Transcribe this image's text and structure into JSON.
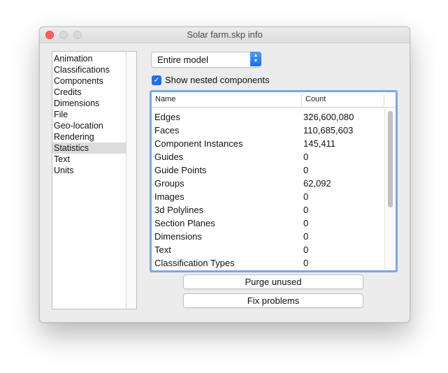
{
  "window": {
    "title": "Solar farm.skp info"
  },
  "sidebar": {
    "items": [
      {
        "label": "Animation"
      },
      {
        "label": "Classifications"
      },
      {
        "label": "Components"
      },
      {
        "label": "Credits"
      },
      {
        "label": "Dimensions"
      },
      {
        "label": "File"
      },
      {
        "label": "Geo-location"
      },
      {
        "label": "Rendering"
      },
      {
        "label": "Statistics",
        "selected": true
      },
      {
        "label": "Text"
      },
      {
        "label": "Units"
      }
    ]
  },
  "scope_popup": {
    "value": "Entire model"
  },
  "nested_checkbox": {
    "label": "Show nested components",
    "checked": true
  },
  "stats_table": {
    "columns": [
      "Name",
      "Count"
    ],
    "rows": [
      {
        "name": "Edges",
        "count": "326,600,080"
      },
      {
        "name": "Faces",
        "count": "110,685,603"
      },
      {
        "name": "Component Instances",
        "count": "145,411"
      },
      {
        "name": "Guides",
        "count": "0"
      },
      {
        "name": "Guide Points",
        "count": "0"
      },
      {
        "name": "Groups",
        "count": "62,092"
      },
      {
        "name": "Images",
        "count": "0"
      },
      {
        "name": "3d Polylines",
        "count": "0"
      },
      {
        "name": "Section Planes",
        "count": "0"
      },
      {
        "name": "Dimensions",
        "count": "0"
      },
      {
        "name": "Text",
        "count": "0"
      },
      {
        "name": "Classification Types",
        "count": "0"
      }
    ]
  },
  "buttons": {
    "purge_label": "Purge unused",
    "fix_label": "Fix problems"
  },
  "colors": {
    "accent": "#1a72f0",
    "focus_ring": "#7aa7e6",
    "close": "#fc605c"
  }
}
